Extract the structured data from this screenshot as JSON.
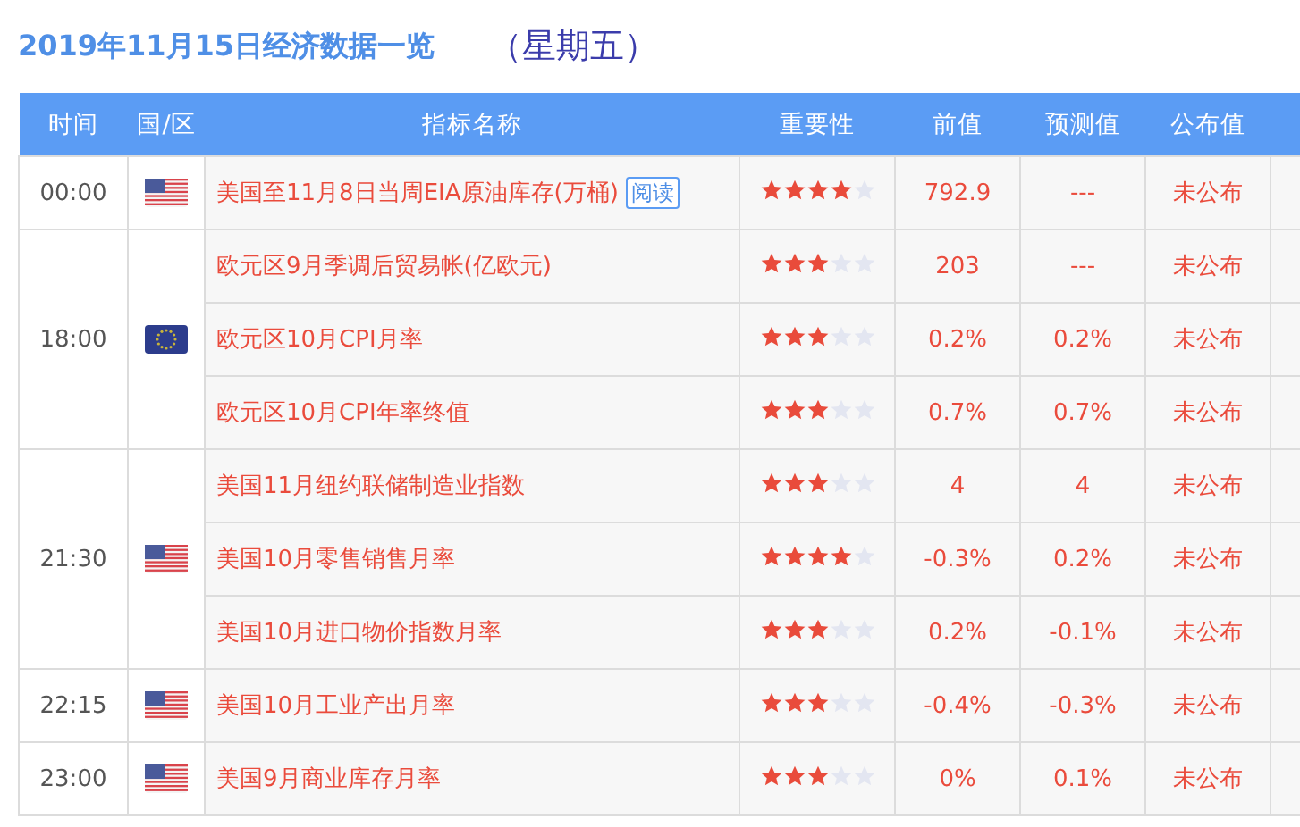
{
  "title": "2019年11月15日经济数据一览",
  "weekday": "（星期五）",
  "columns": [
    "时间",
    "国/区",
    "指标名称",
    "重要性",
    "前值",
    "预测值",
    "公布值"
  ],
  "groups": [
    {
      "time": "00:00",
      "kind": "us",
      "events": [
        {
          "name": "美国至11月8日当周EIA原油库存(万桶)",
          "badge": "阅读",
          "stars": 4,
          "previous": "792.9",
          "forecast": "---",
          "actual": "未公布"
        }
      ]
    },
    {
      "time": "18:00",
      "kind": "eu",
      "events": [
        {
          "name": "欧元区9月季调后贸易帐(亿欧元)",
          "stars": 3,
          "previous": "203",
          "forecast": "---",
          "actual": "未公布"
        },
        {
          "name": "欧元区10月CPI月率",
          "stars": 3,
          "previous": "0.2%",
          "forecast": "0.2%",
          "actual": "未公布"
        },
        {
          "name": "欧元区10月CPI年率终值",
          "stars": 3,
          "previous": "0.7%",
          "forecast": "0.7%",
          "actual": "未公布"
        }
      ]
    },
    {
      "time": "21:30",
      "kind": "us",
      "events": [
        {
          "name": "美国11月纽约联储制造业指数",
          "stars": 3,
          "previous": "4",
          "forecast": "4",
          "actual": "未公布"
        },
        {
          "name": "美国10月零售销售月率",
          "stars": 4,
          "previous": "-0.3%",
          "forecast": "0.2%",
          "actual": "未公布"
        },
        {
          "name": "美国10月进口物价指数月率",
          "stars": 3,
          "previous": "0.2%",
          "forecast": "-0.1%",
          "actual": "未公布"
        }
      ]
    },
    {
      "time": "22:15",
      "kind": "us",
      "events": [
        {
          "name": "美国10月工业产出月率",
          "stars": 3,
          "previous": "-0.4%",
          "forecast": "-0.3%",
          "actual": "未公布"
        }
      ]
    },
    {
      "time": "23:00",
      "kind": "us",
      "events": [
        {
          "name": "美国9月商业库存月率",
          "stars": 3,
          "previous": "0%",
          "forecast": "0.1%",
          "actual": "未公布"
        }
      ]
    }
  ]
}
